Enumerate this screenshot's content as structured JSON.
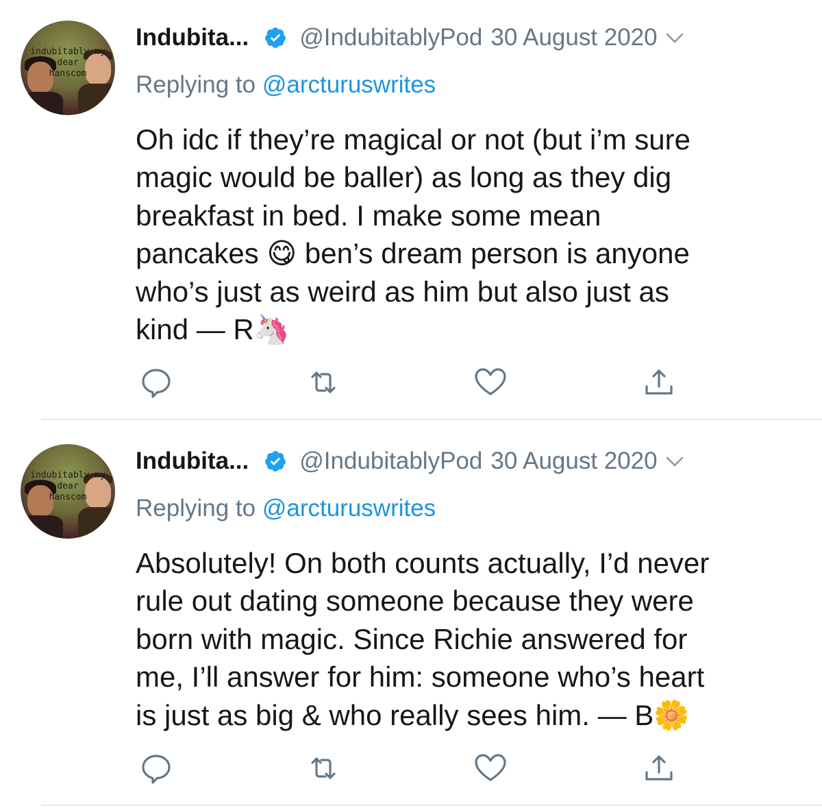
{
  "tweets": [
    {
      "display_name": "Indubita...",
      "handle": "@IndubitablyPod",
      "date": "30 August 2020",
      "replying_prefix": "Replying to ",
      "replying_to": "@arcturuswrites",
      "text_lines": [
        "Oh idc if they’re magical or not (but i’m sure",
        "magic would be baller) as long as they dig",
        "breakfast in bed. I make some mean",
        "pancakes 😋 ben’s dream person is anyone",
        "who’s just as weird as him but also just as",
        "kind — R🦄"
      ],
      "avatar_text": [
        "indubitably my",
        "dear",
        "hanscom"
      ]
    },
    {
      "display_name": "Indubita...",
      "handle": "@IndubitablyPod",
      "date": "30 August 2020",
      "replying_prefix": "Replying to ",
      "replying_to": "@arcturuswrites",
      "text_lines": [
        "Absolutely! On both counts actually, I’d never",
        "rule out dating someone because they were",
        "born with magic. Since Richie answered for",
        "me, I’ll answer for him: someone who’s heart",
        "is just as big & who really sees him. — B🌼"
      ],
      "avatar_text": [
        "indubitably my",
        "dear",
        "hanscom"
      ]
    }
  ],
  "icons": {
    "verified": "verified-badge-icon",
    "caret": "chevron-down-icon",
    "reply": "reply-icon",
    "retweet": "retweet-icon",
    "like": "like-icon",
    "share": "share-icon"
  },
  "colors": {
    "accent": "#1da1f2",
    "mention": "#1b95e0",
    "secondary_text": "#657786",
    "icon_gray": "#657786",
    "divider": "#e1e8ed"
  }
}
